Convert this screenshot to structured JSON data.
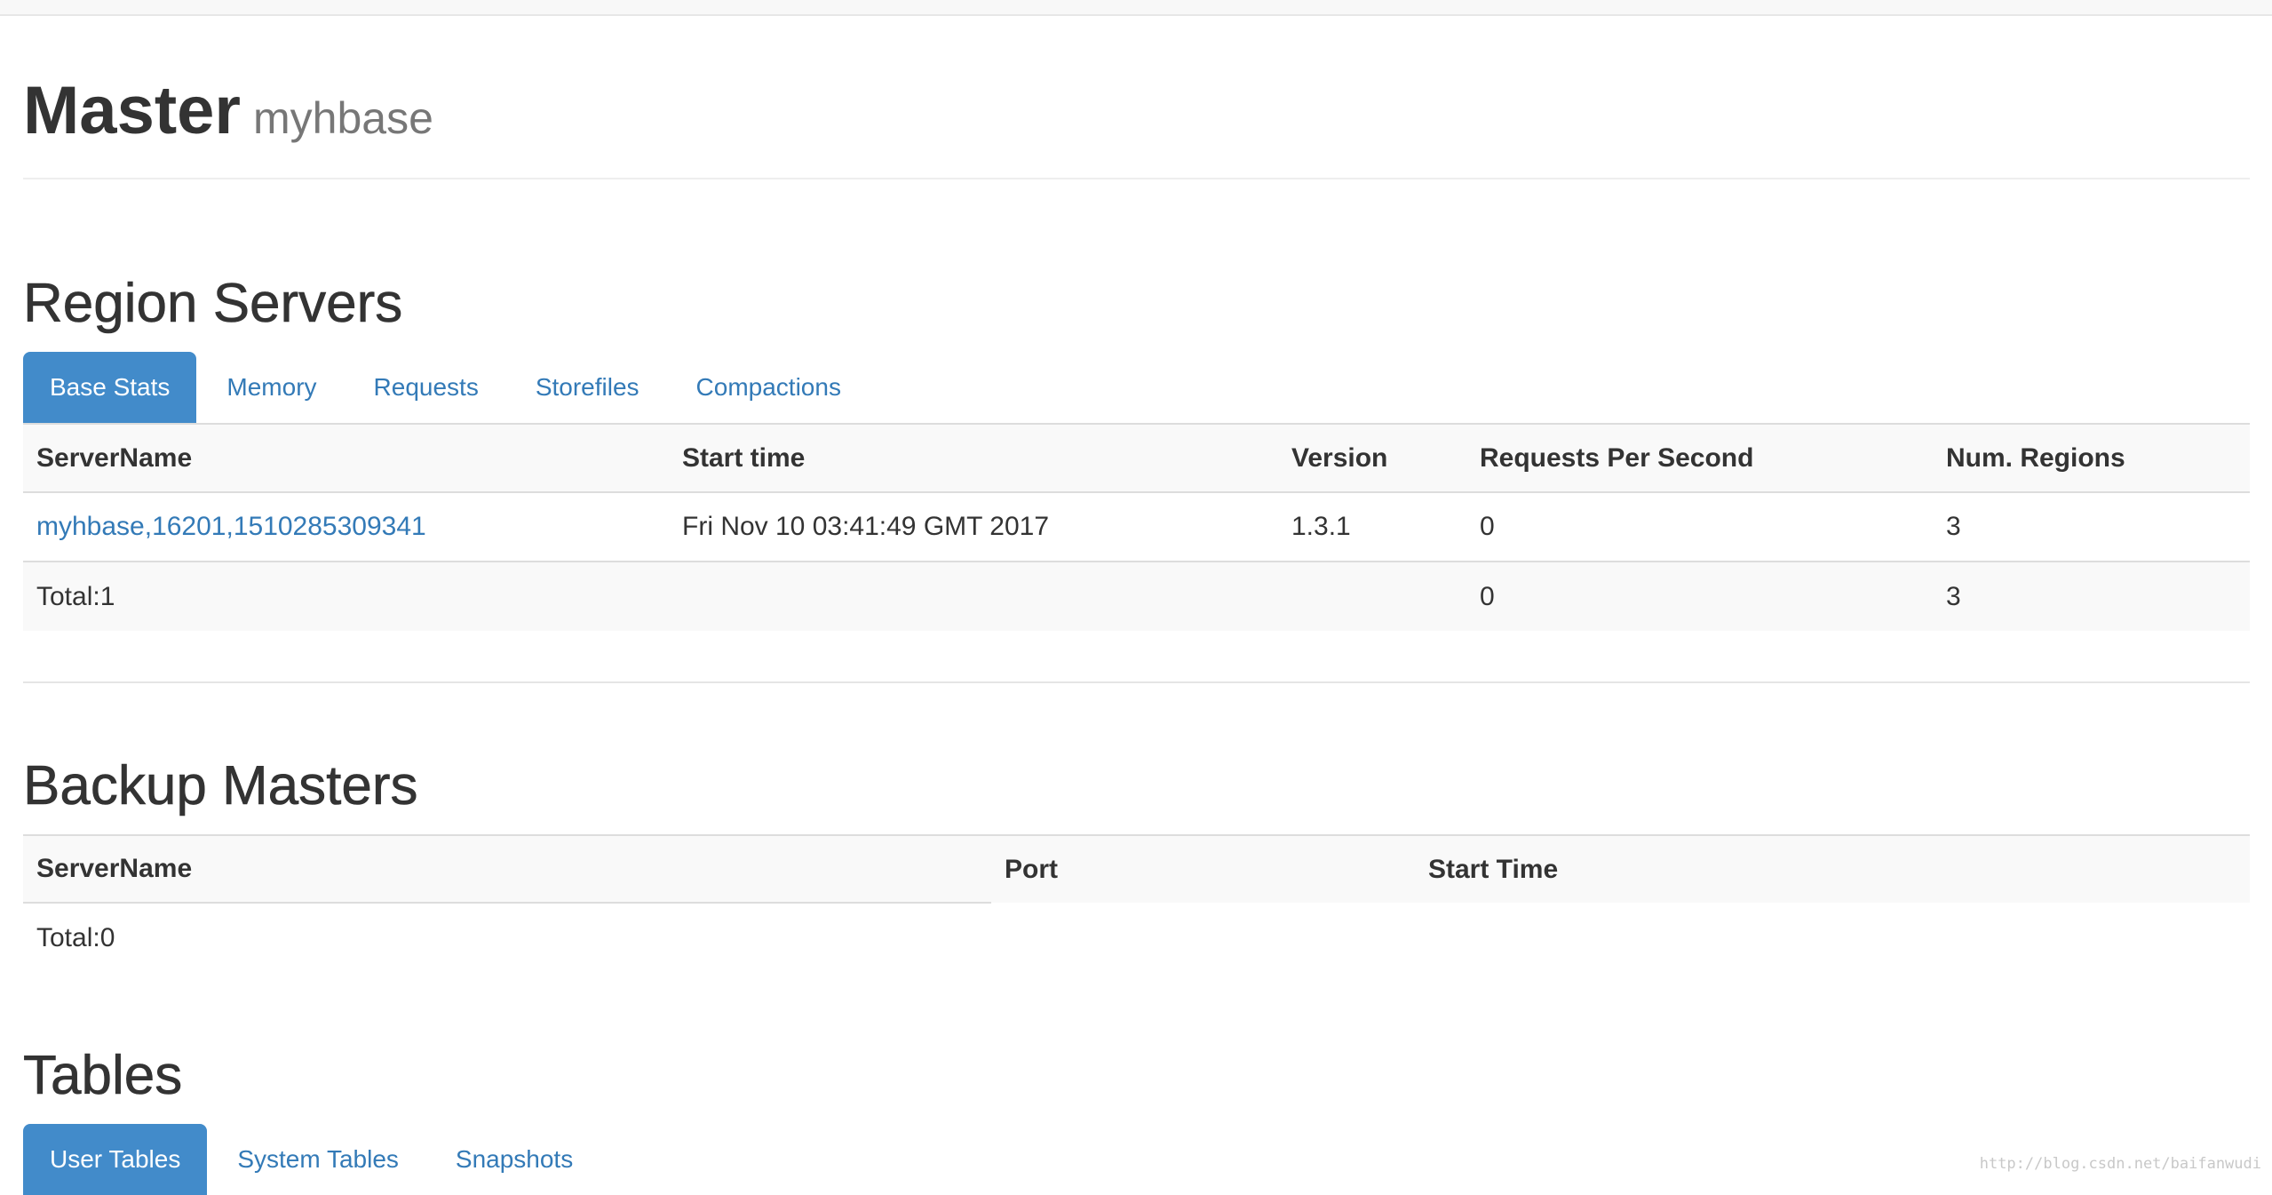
{
  "header": {
    "title": "Master",
    "subtitle": "myhbase"
  },
  "region_servers": {
    "title": "Region Servers",
    "tabs": [
      {
        "label": "Base Stats",
        "active": true
      },
      {
        "label": "Memory",
        "active": false
      },
      {
        "label": "Requests",
        "active": false
      },
      {
        "label": "Storefiles",
        "active": false
      },
      {
        "label": "Compactions",
        "active": false
      }
    ],
    "columns": [
      "ServerName",
      "Start time",
      "Version",
      "Requests Per Second",
      "Num. Regions"
    ],
    "rows": [
      {
        "server_name": "myhbase,16201,1510285309341",
        "start_time": "Fri Nov 10 03:41:49 GMT 2017",
        "version": "1.3.1",
        "requests_per_second": "0",
        "num_regions": "3"
      }
    ],
    "total": {
      "label": "Total:1",
      "requests_per_second": "0",
      "num_regions": "3"
    }
  },
  "backup_masters": {
    "title": "Backup Masters",
    "columns": [
      "ServerName",
      "Port",
      "Start Time"
    ],
    "total": {
      "label": "Total:0"
    }
  },
  "tables": {
    "title": "Tables",
    "tabs": [
      {
        "label": "User Tables",
        "active": true
      },
      {
        "label": "System Tables",
        "active": false
      },
      {
        "label": "Snapshots",
        "active": false
      }
    ]
  },
  "watermark": "http://blog.csdn.net/baifanwudi",
  "colors": {
    "accent": "#428bca",
    "link": "#337ab7",
    "text": "#333333",
    "muted": "#777777"
  }
}
